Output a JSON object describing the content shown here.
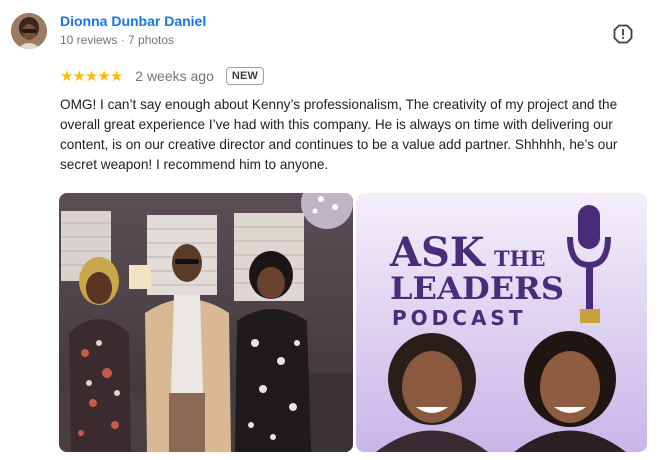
{
  "reviewer": {
    "name": "Dionna Dunbar Daniel",
    "meta": "10 reviews · 7 photos",
    "avatar_icon": "user-avatar-photo"
  },
  "actions": {
    "more_icon": "report-flag-icon"
  },
  "review": {
    "rating": 5,
    "rating_max": 5,
    "date": "2 weeks ago",
    "badge": "NEW",
    "text": "OMG! I can’t say enough about Kenny’s professionalism, The creativity of my project and the overall great experience I’ve had with this company. He is always on time with delivering our content, is on our creative director and continues to be a value add partner. Shhhhh, he’s our secret weapon! I recommend him to anyone."
  },
  "photos": [
    {
      "name": "group-photo"
    },
    {
      "name": "podcast-cover",
      "title_line1_big": "ASK",
      "title_line1_small": "THE",
      "title_line2": "LEADERS",
      "title_line3": "PODCAST",
      "icon": "microphone-icon"
    }
  ],
  "colors": {
    "name_link": "#1a73e8",
    "star": "#fbbc04",
    "podcast_purple": "#4a2d7a",
    "podcast_gold": "#c9a13b"
  }
}
